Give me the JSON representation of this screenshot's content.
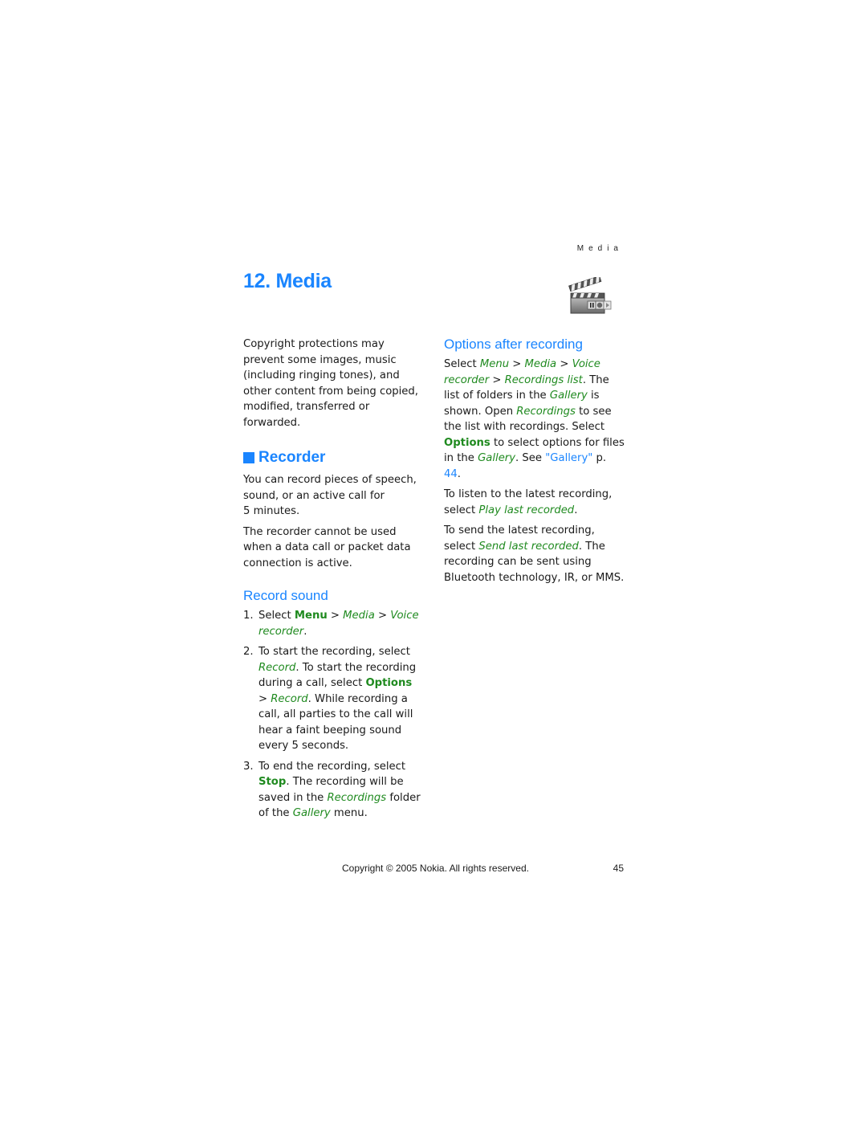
{
  "running_head": "Media",
  "chapter": {
    "title": "12. Media",
    "icon": "clapperboard-media-icon"
  },
  "intro": "Copyright protections may prevent some images, music (including ringing tones), and other content from being copied, modified, transferred or forwarded.",
  "recorder": {
    "heading": "Recorder",
    "p1_a": "You can record pieces of speech, sound, or an active call for",
    "p1_b": "5 minutes.",
    "p2": "The recorder cannot be used when a data call or packet data connection is active."
  },
  "record_sound": {
    "heading": "Record sound",
    "steps": [
      {
        "num": "1.",
        "t1": "Select ",
        "menu": "Menu",
        "sep1": " > ",
        "media": "Media",
        "sep2": " > ",
        "voice": "Voice recorder",
        "t2": "."
      },
      {
        "num": "2.",
        "t1": "To start the recording, select ",
        "record1": "Record",
        "t2": ". To start the recording during a call, select ",
        "options": "Options",
        "t3": " > ",
        "record2": "Record",
        "t4": ". While recording a call, all parties to the call will hear a faint beeping sound every 5 seconds."
      },
      {
        "num": "3.",
        "t1": "To end the recording, select ",
        "stop": "Stop",
        "t2": ". The recording will be saved in the ",
        "recordings": "Recordings",
        "t3": " folder of the ",
        "gallery": "Gallery",
        "t4": " menu."
      }
    ]
  },
  "options_after": {
    "heading": "Options after recording",
    "p1": {
      "t1": "Select ",
      "menu": "Menu",
      "sep1": " > ",
      "media": "Media",
      "sep2": " > ",
      "voice": "Voice recorder",
      "sep3": " > ",
      "list": "Recordings list",
      "t2": ". The list of folders in the ",
      "gallery": "Gallery",
      "t3": " is shown. Open ",
      "recordings": "Recordings",
      "t4": " to see the list with recordings. Select ",
      "options": "Options",
      "t5": " to select options for files in the ",
      "gallery2": "Gallery",
      "t6": ". See ",
      "xref": "\"Gallery\"",
      "t7": " p. ",
      "xref_page": "44",
      "t8": "."
    },
    "p2": {
      "t1": "To listen to the latest recording, select ",
      "play": "Play last recorded",
      "t2": "."
    },
    "p3": {
      "t1": "To send the latest recording, select ",
      "send": "Send last recorded",
      "t2": ". The recording can be sent using Bluetooth technology, IR, or MMS."
    }
  },
  "footer": {
    "copyright": "Copyright © 2005 Nokia. All rights reserved.",
    "page_number": "45"
  },
  "colors": {
    "heading_blue": "#1a85ff",
    "ui_green": "#1f8a1f"
  }
}
